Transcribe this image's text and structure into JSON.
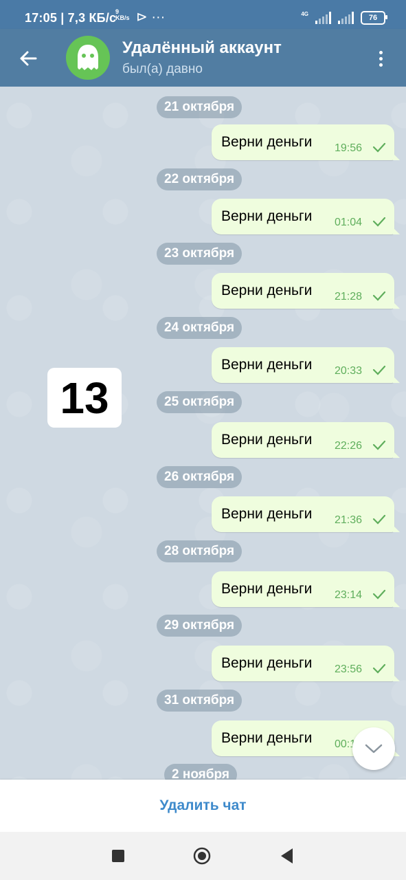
{
  "status_bar": {
    "time_and_speed": "17:05 | 7,3 КБ/с",
    "speed_unit": "9\nKB/s",
    "extra_icons": "⊳ ···",
    "network": "4G",
    "battery": "76"
  },
  "header": {
    "title": "Удалённый аккаунт",
    "subtitle": "был(а) давно"
  },
  "messages": [
    {
      "date": "21 октября",
      "text": "Верни деньги",
      "time": "19:56"
    },
    {
      "date": "22 октября",
      "text": "Верни деньги",
      "time": "01:04"
    },
    {
      "date": "23 октября",
      "text": "Верни деньги",
      "time": "21:28"
    },
    {
      "date": "24 октября",
      "text": "Верни деньги",
      "time": "20:33"
    },
    {
      "date": "25 октября",
      "text": "Верни деньги",
      "time": "22:26"
    },
    {
      "date": "26 октября",
      "text": "Верни деньги",
      "time": "21:36"
    },
    {
      "date": "28 октября",
      "text": "Верни деньги",
      "time": "23:14"
    },
    {
      "date": "29 октября",
      "text": "Верни деньги",
      "time": "23:56"
    },
    {
      "date": "31 октября",
      "text": "Верни деньги",
      "time": "00:1"
    }
  ],
  "last_date": "2 ноября",
  "unread_count": "13",
  "bottom": {
    "delete_label": "Удалить чат"
  },
  "colors": {
    "header": "#517da2",
    "bubble": "#effdde",
    "accent": "#3e8acb",
    "avatar": "#66c456"
  }
}
